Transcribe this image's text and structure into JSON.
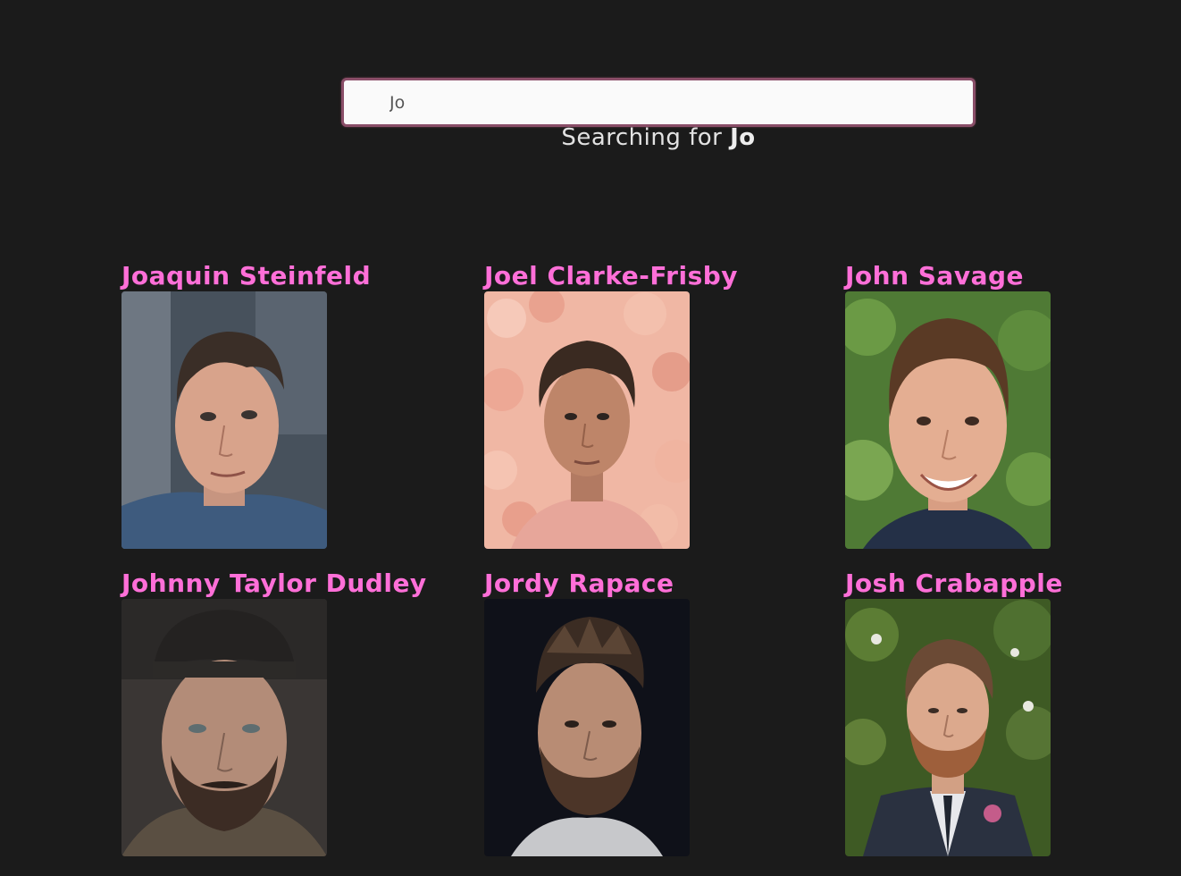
{
  "search": {
    "value": "Jo",
    "status_prefix": "Searching for ",
    "status_term": "Jo"
  },
  "results": [
    {
      "name": "Joaquin Steinfeld"
    },
    {
      "name": "Joel Clarke-Frisby"
    },
    {
      "name": "John Savage"
    },
    {
      "name": "Johnny Taylor Dudley"
    },
    {
      "name": "Jordy Rapace"
    },
    {
      "name": "Josh Crabapple"
    }
  ]
}
